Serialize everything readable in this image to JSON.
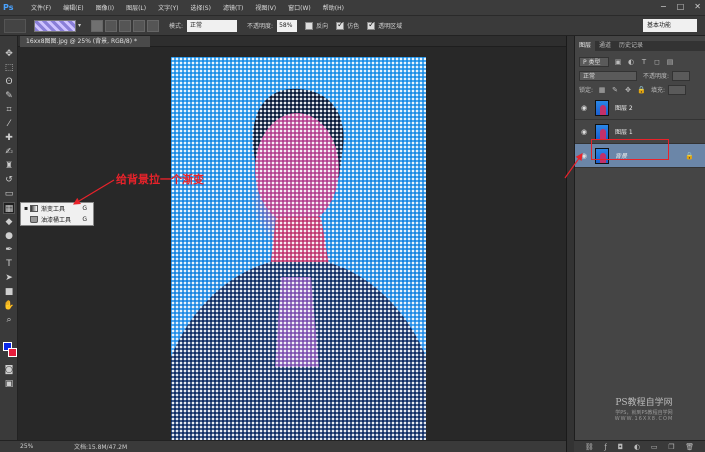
{
  "app": {
    "logo": "Ps"
  },
  "menu": [
    "文件(F)",
    "编辑(E)",
    "图像(I)",
    "图层(L)",
    "文字(Y)",
    "选择(S)",
    "滤镜(T)",
    "视图(V)",
    "窗口(W)",
    "帮助(H)"
  ],
  "window_controls": [
    "−",
    "□",
    "✕"
  ],
  "options": {
    "mode_label": "模式:",
    "mode_value": "正常",
    "opacity_label": "不透明度:",
    "opacity_value": "58%",
    "reverse_label": "反向",
    "dither_label": "仿色",
    "transparency_label": "透明区域",
    "reverse_checked": false,
    "dither_checked": true,
    "transparency_checked": true,
    "workspace": "基本功能"
  },
  "document_tab": {
    "label": "16xx8图图.jpg @ 25% (背景, RGB/8) *"
  },
  "flyout": {
    "items": [
      {
        "label": "渐变工具",
        "key": "G",
        "active": true
      },
      {
        "label": "油漆桶工具",
        "key": "G",
        "active": false
      }
    ]
  },
  "annotation": {
    "text": "给背景拉一个渐变"
  },
  "status": {
    "zoom": "25%",
    "doc_info": "文档:15.8M/47.2M"
  },
  "panel": {
    "tabs": [
      "图层",
      "通道",
      "历史记录"
    ],
    "filter_label": "P 类型",
    "blend_mode": "正常",
    "opacity_label": "不透明度:",
    "lock_label": "锁定:",
    "fill_label": "填充:",
    "layers": [
      {
        "name": "图层 2",
        "selected": false,
        "locked": false
      },
      {
        "name": "图层 1",
        "selected": false,
        "locked": false
      },
      {
        "name": "背景",
        "selected": true,
        "locked": true
      }
    ]
  },
  "watermark": {
    "title": "PS教程自学网",
    "subtitle": "学PS，就到PS教程自学网",
    "url": "WWW.16XX8.COM"
  },
  "colors": {
    "foreground": "#0a27e8",
    "background": "#e51c3b",
    "annotation": "#e8222a",
    "photo_bg": "#1a8fe8",
    "selected_layer": "#6b86a8"
  },
  "icons": {
    "tools": [
      "move-icon",
      "marquee-icon",
      "lasso-icon",
      "quick-select-icon",
      "crop-icon",
      "eyedropper-icon",
      "healing-brush-icon",
      "brush-icon",
      "clone-stamp-icon",
      "history-brush-icon",
      "eraser-icon",
      "gradient-icon",
      "blur-icon",
      "dodge-icon",
      "pen-icon",
      "type-icon",
      "path-select-icon",
      "rectangle-icon",
      "hand-icon",
      "zoom-icon"
    ],
    "panel_bottom": [
      "link-icon",
      "fx-icon",
      "mask-icon",
      "adjustment-icon",
      "group-icon",
      "new-layer-icon",
      "trash-icon"
    ]
  }
}
